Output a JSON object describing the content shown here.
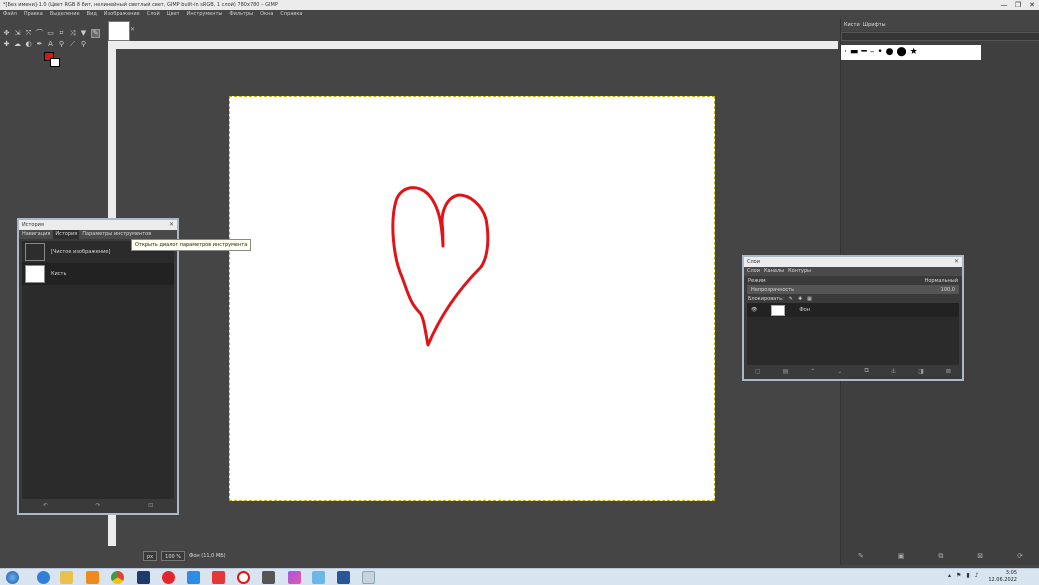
{
  "window": {
    "title": "*[Без имени]-1.0 (Цвет RGB 8 бит, нелинейный светлый свет, GIMP built-in sRGB, 1 слой) 780x780 – GIMP",
    "min": "—",
    "max": "❐",
    "close": "✕"
  },
  "menu": [
    "Файл",
    "Правка",
    "Выделение",
    "Вид",
    "Изображение",
    "Слой",
    "Цвет",
    "Инструменты",
    "Фильтры",
    "Окна",
    "Справка"
  ],
  "toolbox": {
    "fg_color": "#d8161a",
    "bg_color": "#ffffff"
  },
  "image_tab": {
    "close": "✕"
  },
  "statusbar": {
    "unit": "px",
    "zoom": "100 %",
    "info": "Фон (11,0 МБ)"
  },
  "history": {
    "title": "История",
    "tabs": [
      "Навигация",
      "История",
      "Параметры инструментов"
    ],
    "items": [
      {
        "label": "[Чистое изображение]"
      },
      {
        "label": "Кисть"
      }
    ]
  },
  "tooltip": "Открыть диалог параметров инструмента",
  "layers": {
    "title": "Слои",
    "tabs": [
      "Слои",
      "Каналы",
      "Контуры"
    ],
    "mode_label": "Режим",
    "mode_value": "Нормальный",
    "opacity_label": "Непрозрачность",
    "opacity_value": "100,0",
    "lock_label": "Блокировать:",
    "layer_name": "Фон"
  },
  "brushes": {
    "tabs": [
      "Кисти",
      "Шрифты"
    ]
  },
  "clock": {
    "time": "3:05",
    "date": "12.06.2022"
  }
}
